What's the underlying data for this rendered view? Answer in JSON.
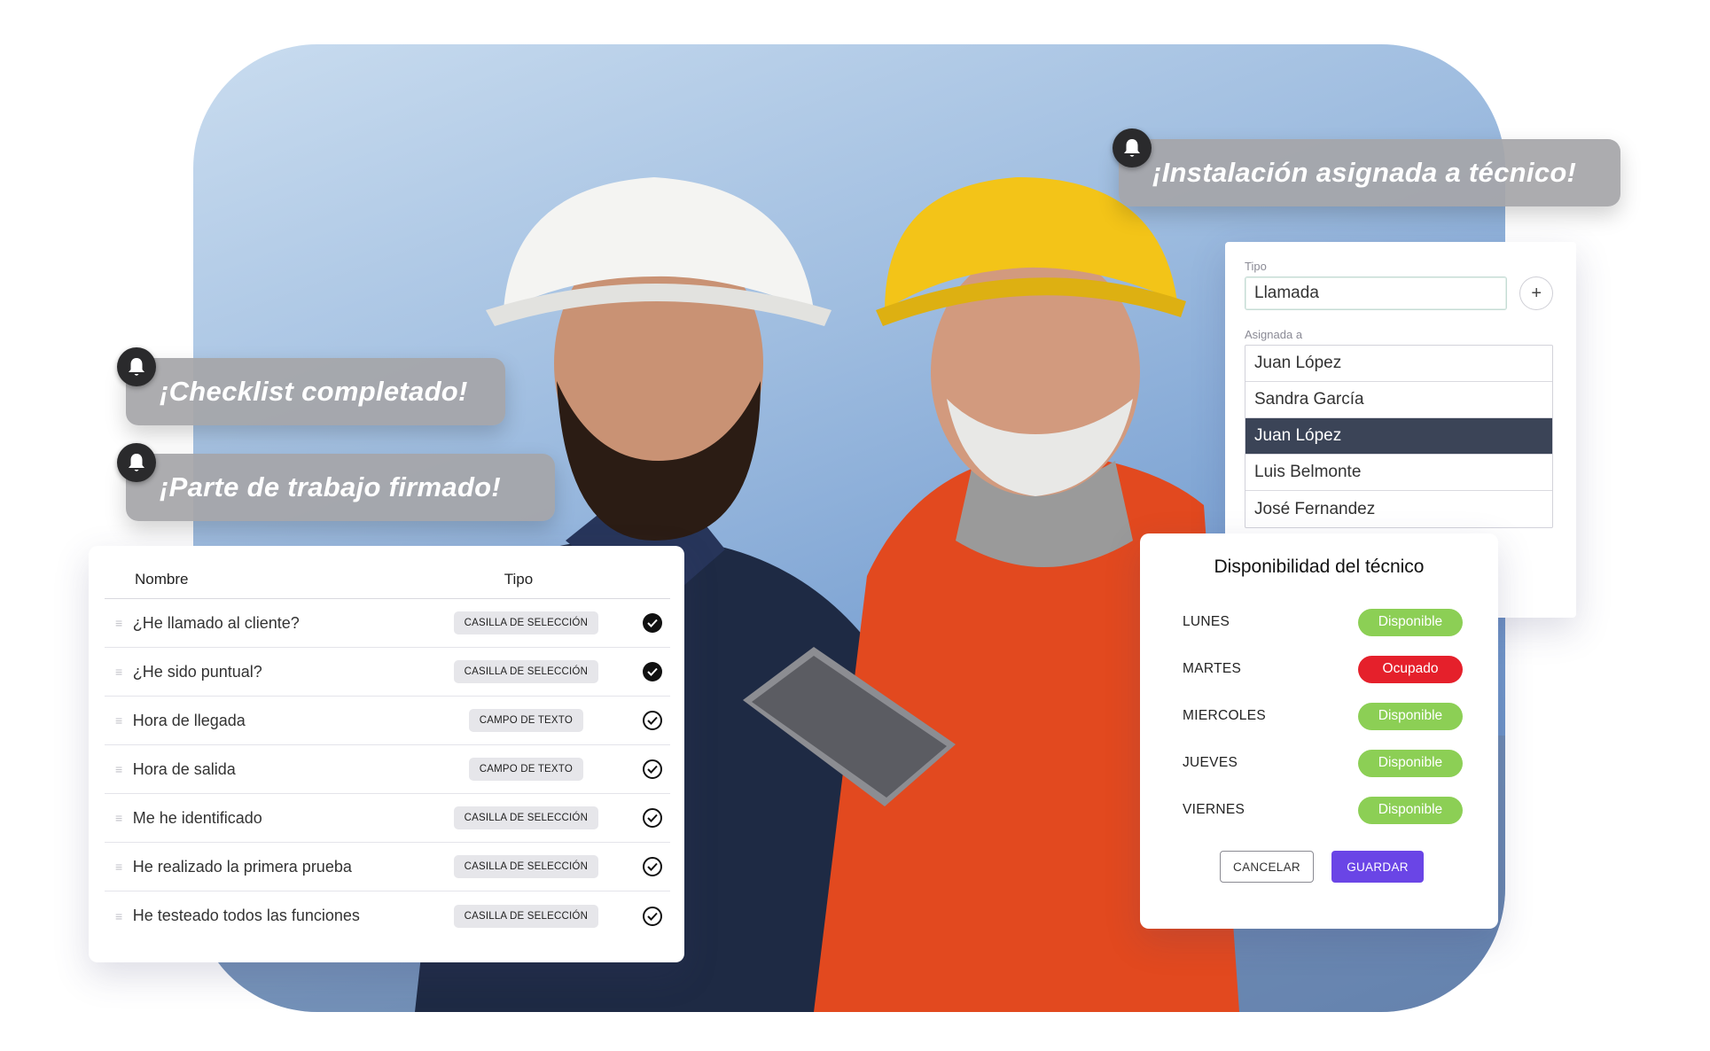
{
  "notifications": {
    "installation": "¡Instalación asignada a técnico!",
    "checklist": "¡Checklist completado!",
    "work_report": "¡Parte de trabajo firmado!"
  },
  "checklist": {
    "header_name": "Nombre",
    "header_type": "Tipo",
    "rows": [
      {
        "name": "¿He llamado al cliente?",
        "type": "CASILLA DE SELECCIÓN",
        "check": "filled"
      },
      {
        "name": "¿He sido puntual?",
        "type": "CASILLA DE SELECCIÓN",
        "check": "filled"
      },
      {
        "name": "Hora de llegada",
        "type": "CAMPO DE TEXTO",
        "check": "outline"
      },
      {
        "name": "Hora de salida",
        "type": "CAMPO DE TEXTO",
        "check": "outline"
      },
      {
        "name": "Me he identificado",
        "type": "CASILLA DE SELECCIÓN",
        "check": "outline"
      },
      {
        "name": "He realizado la primera prueba",
        "type": "CASILLA DE SELECCIÓN",
        "check": "outline"
      },
      {
        "name": "He testeado todos las funciones",
        "type": "CASILLA DE SELECCIÓN",
        "check": "outline"
      }
    ]
  },
  "assign_form": {
    "tipo_label": "Tipo",
    "tipo_value": "Llamada",
    "plus_label": "+",
    "asignada_label": "Asignada a",
    "options": [
      "Juan López",
      "Sandra García",
      "Juan López",
      "Luis Belmonte",
      "José Fernandez"
    ],
    "selected_index": 2
  },
  "availability": {
    "title": "Disponibilidad del técnico",
    "days": [
      {
        "day": "LUNES",
        "status": "Disponible",
        "color": "#8ccf55"
      },
      {
        "day": "MARTES",
        "status": "Ocupado",
        "color": "#e5202b"
      },
      {
        "day": "MIERCOLES",
        "status": "Disponible",
        "color": "#8ccf55"
      },
      {
        "day": "JUEVES",
        "status": "Disponible",
        "color": "#8ccf55"
      },
      {
        "day": "VIERNES",
        "status": "Disponible",
        "color": "#8ccf55"
      }
    ],
    "cancel_label": "CANCELAR",
    "save_label": "GUARDAR"
  },
  "icons": {
    "notification": "bell-icon",
    "drag": "drag-handle-icon",
    "check": "check-circle-icon"
  },
  "colors": {
    "accent": "#6a45e6",
    "selected_row": "#3b4457"
  }
}
